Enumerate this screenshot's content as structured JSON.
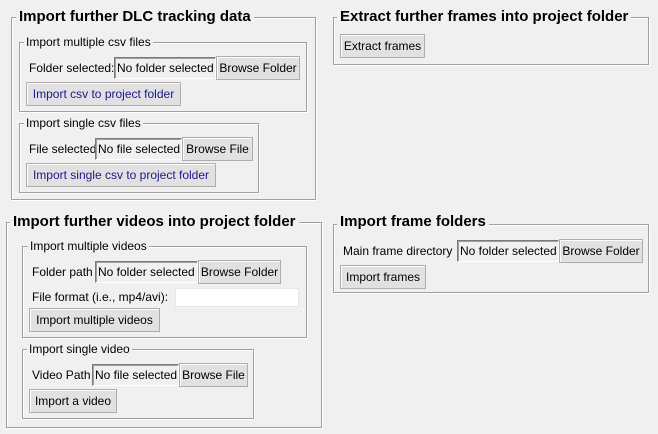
{
  "dlc": {
    "title": "Import further DLC tracking data",
    "multiple": {
      "title": "Import multiple csv files",
      "folder_label": "Folder selected:",
      "folder_value": "No folder selected",
      "browse_label": "Browse Folder",
      "import_label": "Import csv to project folder"
    },
    "single": {
      "title": "Import single csv files",
      "file_label": "File selected",
      "file_value": "No file selected",
      "browse_label": "Browse File",
      "import_label": "Import single csv to project folder"
    }
  },
  "extract": {
    "title": "Extract further frames into project folder",
    "button_label": "Extract frames"
  },
  "videos": {
    "title": "Import further videos into project folder",
    "multiple": {
      "title": "Import multiple videos",
      "folder_label": "Folder path",
      "folder_value": "No folder selected",
      "browse_label": "Browse Folder",
      "format_label": "File format (i.e., mp4/avi):",
      "format_value": "",
      "import_label": "Import multiple videos"
    },
    "single": {
      "title": "Import single video",
      "path_label": "Video Path",
      "path_value": "No file selected",
      "browse_label": "Browse File",
      "import_label": "Import a video"
    }
  },
  "frames": {
    "title": "Import frame folders",
    "dir_label": "Main frame directory",
    "dir_value": "No folder selected",
    "browse_label": "Browse Folder",
    "import_label": "Import frames"
  }
}
